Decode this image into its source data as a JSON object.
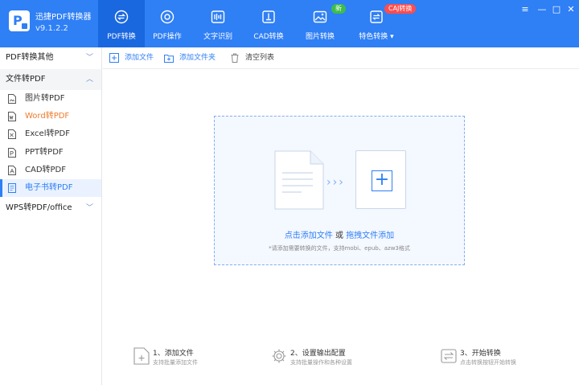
{
  "app": {
    "title": "迅捷PDF转换器",
    "version": "v9.1.2.2",
    "logo_letter": "P"
  },
  "nav_tabs": [
    {
      "label": "PDF转换",
      "icon": "convert-icon",
      "active": true
    },
    {
      "label": "PDF操作",
      "icon": "pdf-operate-icon"
    },
    {
      "label": "文字识别",
      "icon": "ocr-icon"
    },
    {
      "label": "CAD转换",
      "icon": "cad-icon"
    },
    {
      "label": "图片转换",
      "icon": "image-icon",
      "badge": "新"
    },
    {
      "label": "特色转换",
      "icon": "special-convert-icon",
      "badge": "CAJ转换"
    }
  ],
  "window_controls": {
    "menu": "≡",
    "minimize": "—",
    "maximize": "□",
    "close": "✕"
  },
  "sidebar": {
    "groups": [
      {
        "label": "PDF转换其他",
        "collapsed": true
      },
      {
        "label": "文件转PDF",
        "expanded": true
      },
      {
        "label": "WPS转PDF/office",
        "collapsed": true
      }
    ],
    "items": [
      {
        "label": "图片转PDF"
      },
      {
        "label": "Word转PDF",
        "highlight": true
      },
      {
        "label": "Excel转PDF"
      },
      {
        "label": "PPT转PDF"
      },
      {
        "label": "CAD转PDF"
      },
      {
        "label": "电子书转PDF",
        "selected": true
      }
    ]
  },
  "toolbar": {
    "add_file": "添加文件",
    "add_folder": "添加文件夹",
    "clear_list": "清空列表"
  },
  "dropzone": {
    "click_add": "点击添加文件",
    "or": "或",
    "drag_add": "拖拽文件添加",
    "hint": "*请添加需要转换的文件，支持mobi、epub、azw3格式"
  },
  "steps": [
    {
      "title": "1、添加文件",
      "subtitle": "支持批量添加文件"
    },
    {
      "title": "2、设置输出配置",
      "subtitle": "支持批量操作和各种设置"
    },
    {
      "title": "3、开始转换",
      "subtitle": "点击转换按钮开始转换"
    }
  ],
  "colors": {
    "brand": "#2f7ff5",
    "active_tab": "#1a68e0",
    "highlight": "#ef7b2b",
    "badge_new": "#3fbd4a",
    "badge_caj": "#ff4d4f"
  }
}
